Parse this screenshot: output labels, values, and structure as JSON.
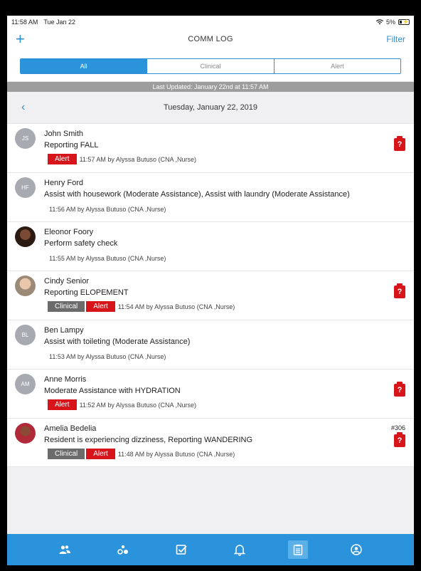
{
  "status": {
    "time": "11:58 AM",
    "date": "Tue Jan 22",
    "battery": "5%"
  },
  "nav": {
    "add": "+",
    "title": "COMM LOG",
    "filter": "Filter"
  },
  "segments": [
    "All",
    "Clinical",
    "Alert"
  ],
  "updated": "Last Updated: January 22nd at 11:57 AM",
  "datebar": {
    "back": "‹",
    "date": "Tuesday, January 22, 2019"
  },
  "entries": [
    {
      "initials": "JS",
      "name": "John Smith",
      "desc": "Reporting FALL",
      "tags": [
        "Alert"
      ],
      "time": "11:57 AM by Alyssa Butuso (CNA ,Nurse)",
      "clip": "?"
    },
    {
      "initials": "HF",
      "name": "Henry Ford",
      "desc": "Assist with housework (Moderate Assistance), Assist with laundry (Moderate Assistance)",
      "tags": [],
      "time": "11:56 AM by Alyssa Butuso (CNA ,Nurse)"
    },
    {
      "initials": "",
      "name": "Eleonor Foory",
      "desc": "Perform safety check",
      "tags": [],
      "time": "11:55 AM by Alyssa Butuso (CNA ,Nurse)"
    },
    {
      "initials": "",
      "name": "Cindy Senior",
      "desc": "Reporting ELOPEMENT",
      "tags": [
        "Clinical",
        "Alert"
      ],
      "time": "11:54 AM by Alyssa Butuso (CNA ,Nurse)",
      "clip": "?"
    },
    {
      "initials": "BL",
      "name": "Ben Lampy",
      "desc": "Assist with toileting (Moderate Assistance)",
      "tags": [],
      "time": "11:53 AM by Alyssa Butuso (CNA ,Nurse)"
    },
    {
      "initials": "AM",
      "name": "Anne  Morris",
      "desc": "Moderate Assistance with HYDRATION",
      "tags": [
        "Alert"
      ],
      "time": "11:52 AM by Alyssa Butuso (CNA ,Nurse)",
      "clip": "?"
    },
    {
      "initials": "",
      "name": "Amelia  Bedelia",
      "desc": "Resident is experiencing dizziness, Reporting WANDERING",
      "tags": [
        "Clinical",
        "Alert"
      ],
      "time": "11:48 AM by Alyssa Butuso (CNA ,Nurse)",
      "clip": "?",
      "room": "#306"
    }
  ],
  "tabs": [
    "residents-icon",
    "care-icon",
    "tasks-icon",
    "bell-icon",
    "comm-log-icon",
    "profile-icon"
  ],
  "colors": {
    "accent": "#2b93db",
    "alert": "#d8141b",
    "clinical": "#6b6b6b"
  }
}
